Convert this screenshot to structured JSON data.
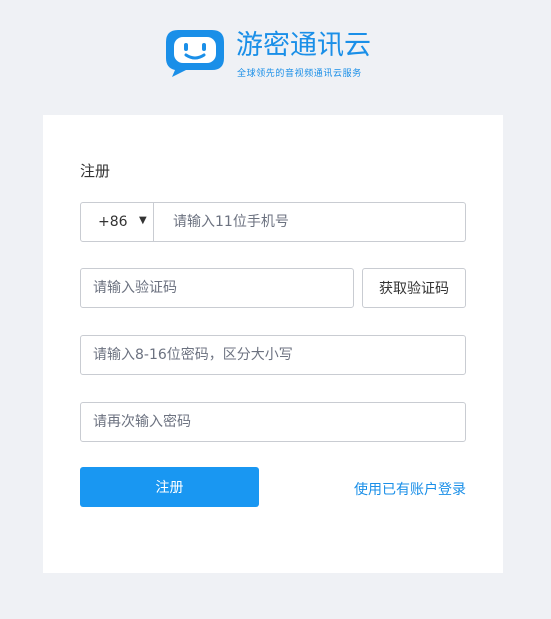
{
  "brand": {
    "name": "游密通讯云",
    "tagline": "全球领先的音视频通讯云服务",
    "logo_icon": "chat-bubble-smile-icon",
    "color": "#1a8fe8"
  },
  "form": {
    "title": "注册",
    "country_code": "+86",
    "phone_placeholder": "请输入11位手机号",
    "code_placeholder": "请输入验证码",
    "get_code_label": "获取验证码",
    "password_placeholder": "请输入8-16位密码，区分大小写",
    "confirm_password_placeholder": "请再次输入密码",
    "register_label": "注册",
    "login_link": "使用已有账户登录"
  },
  "colors": {
    "background": "#eff1f5",
    "primary": "#1997f2",
    "border": "#c9ccd2"
  }
}
